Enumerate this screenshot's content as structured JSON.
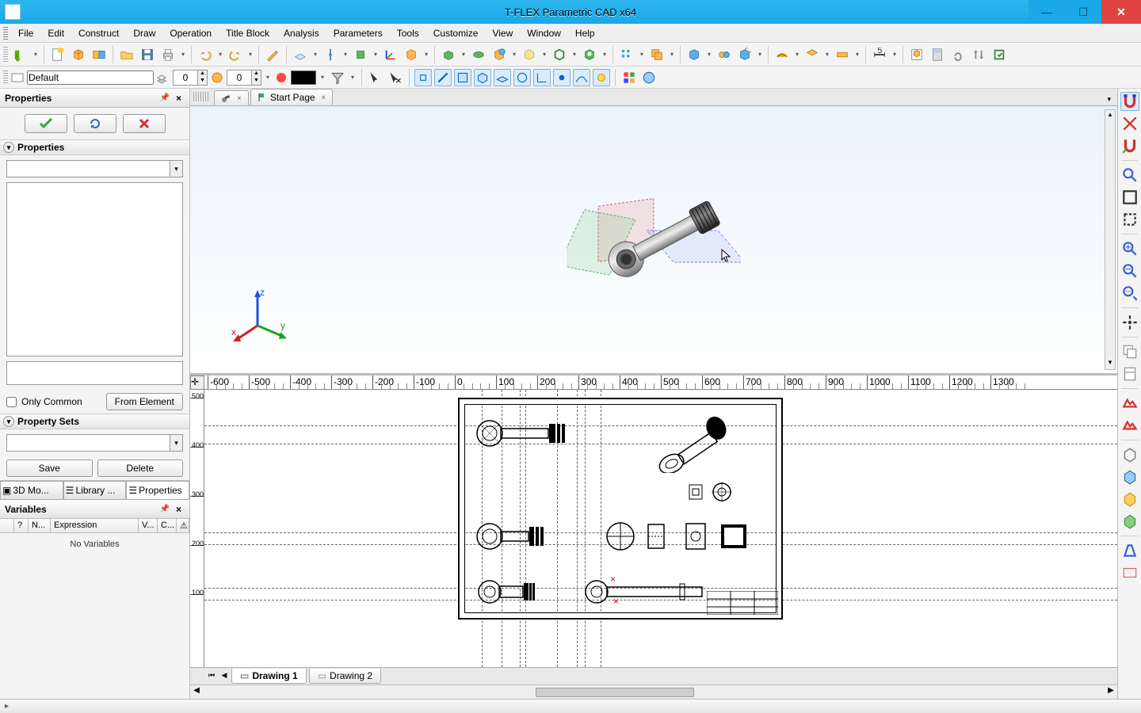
{
  "window": {
    "title": "T-FLEX Parametric CAD x64"
  },
  "menu": [
    "File",
    "Edit",
    "Construct",
    "Draw",
    "Operation",
    "Title Block",
    "Analysis",
    "Parameters",
    "Tools",
    "Customize",
    "View",
    "Window",
    "Help"
  ],
  "layer": {
    "name": "Default",
    "level": "0",
    "priority": "0"
  },
  "properties_panel": {
    "title": "Properties",
    "subheader": "Properties",
    "only_common": "Only Common",
    "from_element": "From Element",
    "propsets": "Property Sets",
    "save": "Save",
    "delete": "Delete",
    "bottom_tabs": [
      "3D Mo...",
      "Library ...",
      "Properties"
    ]
  },
  "variables_panel": {
    "title": "Variables",
    "cols": [
      "",
      "?",
      "N...",
      "Expression",
      "V...",
      "C..."
    ],
    "empty": "No Variables"
  },
  "doc_tabs": [
    {
      "label": "",
      "has_icon": true
    },
    {
      "label": "Start Page",
      "has_icon": true
    }
  ],
  "page_tabs": [
    "Drawing 1",
    "Drawing 2"
  ],
  "ruler_marks": [
    "-600",
    "-500",
    "-400",
    "-300",
    "-200",
    "-100",
    "0",
    "100",
    "200",
    "300",
    "400",
    "500",
    "600",
    "700",
    "800",
    "900",
    "1000",
    "1100",
    "1200",
    "1300"
  ],
  "vruler_marks": [
    "500",
    "400",
    "300",
    "200",
    "100"
  ],
  "axes": {
    "x": "x",
    "y": "y",
    "z": "z"
  }
}
